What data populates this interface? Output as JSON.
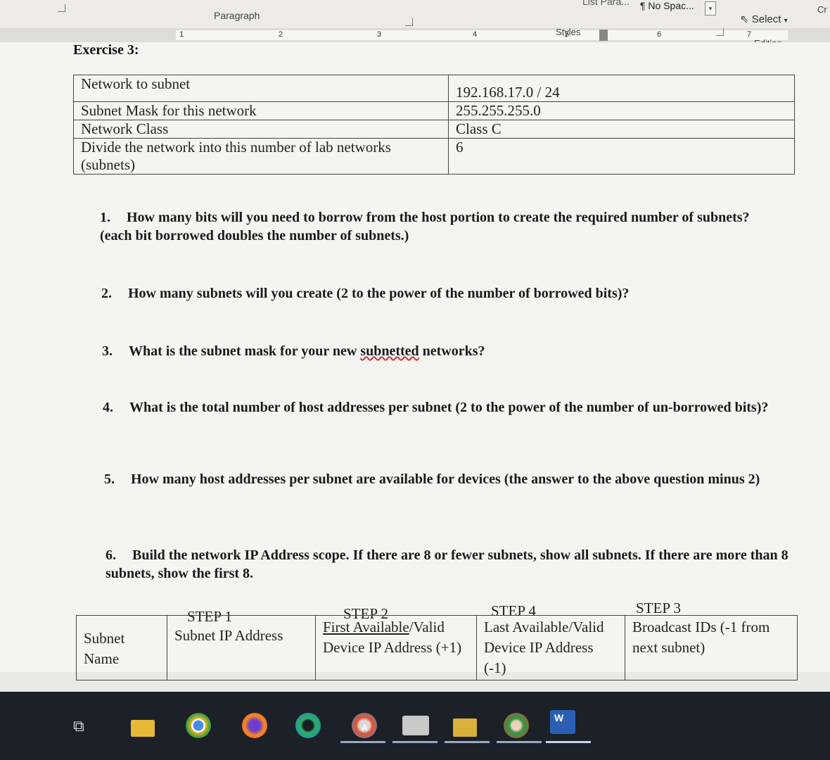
{
  "ribbon": {
    "group_paragraph": "Paragraph",
    "group_styles": "Styles",
    "group_editing": "Editing",
    "style_list_para": "List Para...",
    "style_no_spacing": "¶ No Spac...",
    "select_button": "Select",
    "cut_off_label": "Cr"
  },
  "ruler": {
    "marks": [
      "1",
      "2",
      "3",
      "4",
      "5",
      "6",
      "7"
    ]
  },
  "document": {
    "title": "Exercise 3:",
    "info_table": [
      {
        "label": "Network to subnet",
        "value": "192.168.17.0 / 24"
      },
      {
        "label": "Subnet Mask for this network",
        "value": "255.255.255.0"
      },
      {
        "label": "Network Class",
        "value": "Class C"
      },
      {
        "label": "Divide the network into this number of lab networks (subnets)",
        "value": "6"
      }
    ],
    "questions": [
      {
        "num": "1.",
        "text": "How many bits will you need to borrow from the host portion to create the required number of subnets? (each bit borrowed doubles the number of subnets.)"
      },
      {
        "num": "2.",
        "text": "How many subnets will you create (2 to the power of the number of borrowed bits)?"
      },
      {
        "num": "3.",
        "text_before": "What is the subnet mask for your new ",
        "text_flagged": "subnetted",
        "text_after": " networks?"
      },
      {
        "num": "4.",
        "text": "What is the total number of host addresses per subnet (2 to the power of the number of un-borrowed bits)?"
      },
      {
        "num": "5.",
        "text": "How many host addresses per subnet are available for devices (the answer to the above question minus 2)"
      },
      {
        "num": "6.",
        "text": "Build the network IP Address scope.  If there are 8 or fewer subnets, show all subnets.  If there are more than 8 subnets, show the first 8."
      }
    ],
    "steps": [
      "STEP 1",
      "STEP 2",
      "STEP 4",
      "STEP 3"
    ],
    "scope_headers": {
      "subnet_name": "Subnet Name",
      "subnet_ip": "Subnet IP Address",
      "first_available_a": "First Available",
      "first_available_b": "/Valid Device IP Address (+1)",
      "last_available": "Last Available/Valid Device IP Address (-1)",
      "broadcast": "Broadcast IDs (-1 from next subnet)"
    }
  },
  "taskbar": {
    "icons": [
      "task-view-icon",
      "file-explorer-icon",
      "chrome-icon",
      "firefox-icon",
      "edge-icon",
      "chrome-profile-icon",
      "fax-icon",
      "folder-icon",
      "chrome-user-icon",
      "word-icon"
    ],
    "word_letter": "W",
    "profile_letter": "A"
  }
}
